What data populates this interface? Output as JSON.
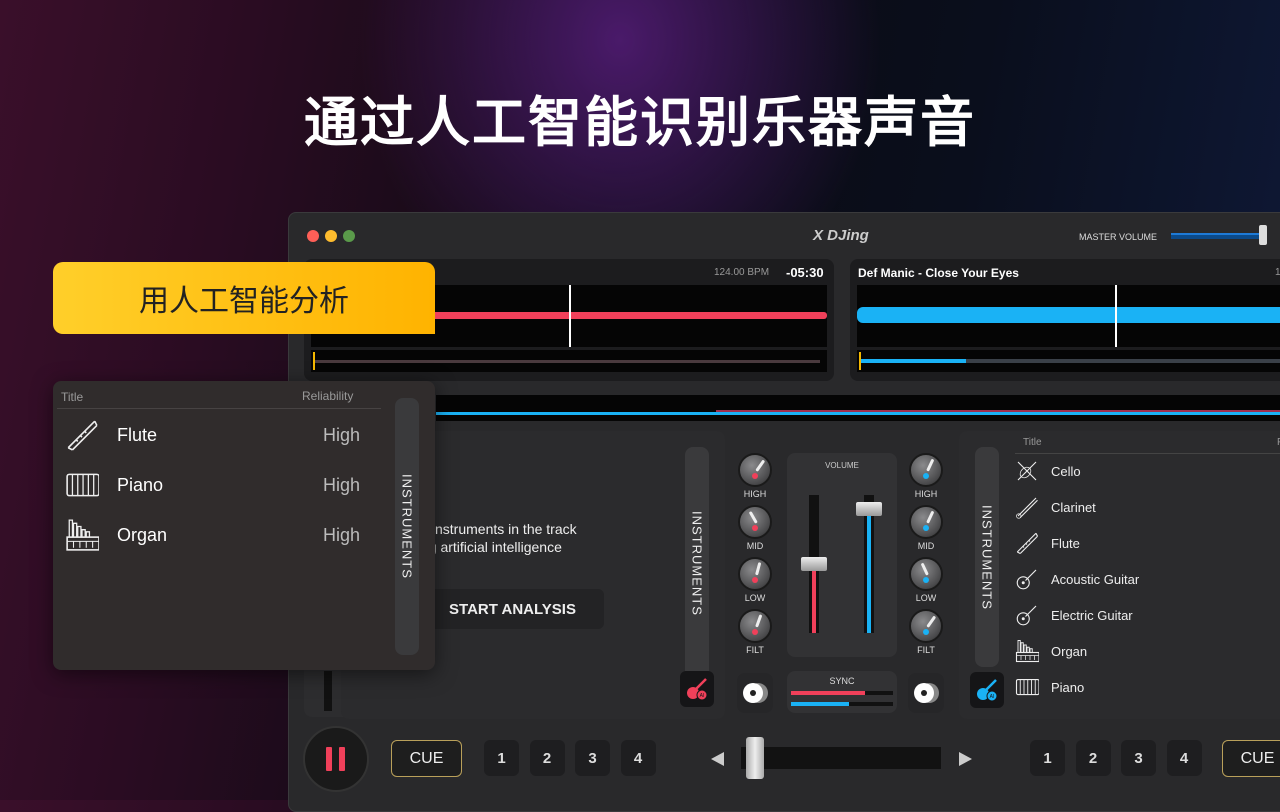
{
  "headline": "通过人工智能识别乐器声音",
  "badge": "用人工智能分析",
  "window": {
    "title": "X DJing",
    "master_volume_label": "MASTER VOLUME",
    "master_volume": 0.95
  },
  "deck_a": {
    "bpm": "124.00 BPM",
    "time": "-05:30",
    "color": "#f0405a"
  },
  "deck_b": {
    "title": "Def Manic - Close Your Eyes",
    "bpm_partial": "1",
    "color": "#1ab2f5"
  },
  "overlay_panel": {
    "col_title": "Title",
    "col_reliability": "Reliability",
    "tab": "INSTRUMENTS",
    "rows": [
      {
        "icon": "flute-icon",
        "title": "Flute",
        "reliability": "High"
      },
      {
        "icon": "piano-icon",
        "title": "Piano",
        "reliability": "High"
      },
      {
        "icon": "organ-icon",
        "title": "Organ",
        "reliability": "High"
      }
    ]
  },
  "left_panel": {
    "line1": "y instruments in the track",
    "line2": "ng artificial intelligence",
    "start": "START ANALYSIS",
    "tab": "INSTRUMENTS"
  },
  "mixer": {
    "knobs": [
      "HIGH",
      "MID",
      "LOW",
      "FILT"
    ],
    "volume_label": "VOLUME",
    "sync_label": "SYNC",
    "volume_a": 0.5,
    "volume_b": 0.9,
    "sync_a": 0.73,
    "sync_b": 0.57
  },
  "right_panel": {
    "tab": "INSTRUMENTS",
    "col_title": "Title",
    "col_partial": "F",
    "items": [
      "Cello",
      "Clarinet",
      "Flute",
      "Acoustic Guitar",
      "Electric Guitar",
      "Organ",
      "Piano"
    ]
  },
  "bottom": {
    "cue": "CUE",
    "hotcues": [
      "1",
      "2",
      "3",
      "4"
    ],
    "crossfader": 0.03
  }
}
